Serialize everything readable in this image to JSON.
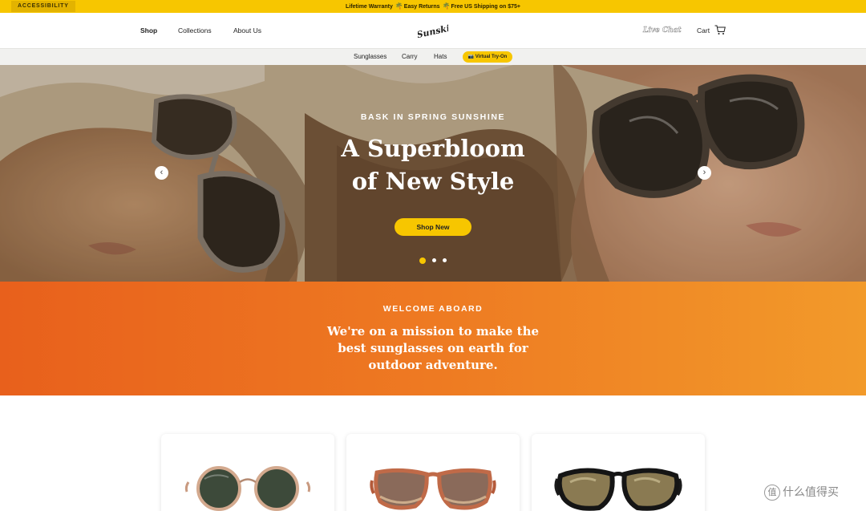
{
  "announcement": {
    "accessibility_label": "ACCESSIBILITY",
    "items": [
      "Lifetime Warranty",
      "Easy Returns",
      "Free US Shipping on $75+"
    ],
    "palm_glyph": "🌴"
  },
  "header": {
    "nav": [
      "Shop",
      "Collections",
      "About Us"
    ],
    "logo": "Sunski",
    "live_chat": "Live Chat",
    "cart_label": "Cart"
  },
  "subnav": {
    "items": [
      "Sunglasses",
      "Carry",
      "Hats"
    ],
    "tryon_label": "Virtual Try-On"
  },
  "hero": {
    "eyebrow": "BASK IN SPRING SUNSHINE",
    "title_line1": "A Superbloom",
    "title_line2": "of New Style",
    "cta": "Shop New",
    "prev_glyph": "‹",
    "next_glyph": "›",
    "slide_count": 3,
    "active_slide": 1
  },
  "mission": {
    "eyebrow": "WELCOME ABOARD",
    "text": "We're on a mission to make the best sunglasses on earth for outdoor adventure."
  },
  "watermark": {
    "icon_glyph": "值",
    "text": "什么值得买"
  },
  "colors": {
    "brand_yellow": "#f7c600",
    "mission_orange": "#ee7a22"
  }
}
